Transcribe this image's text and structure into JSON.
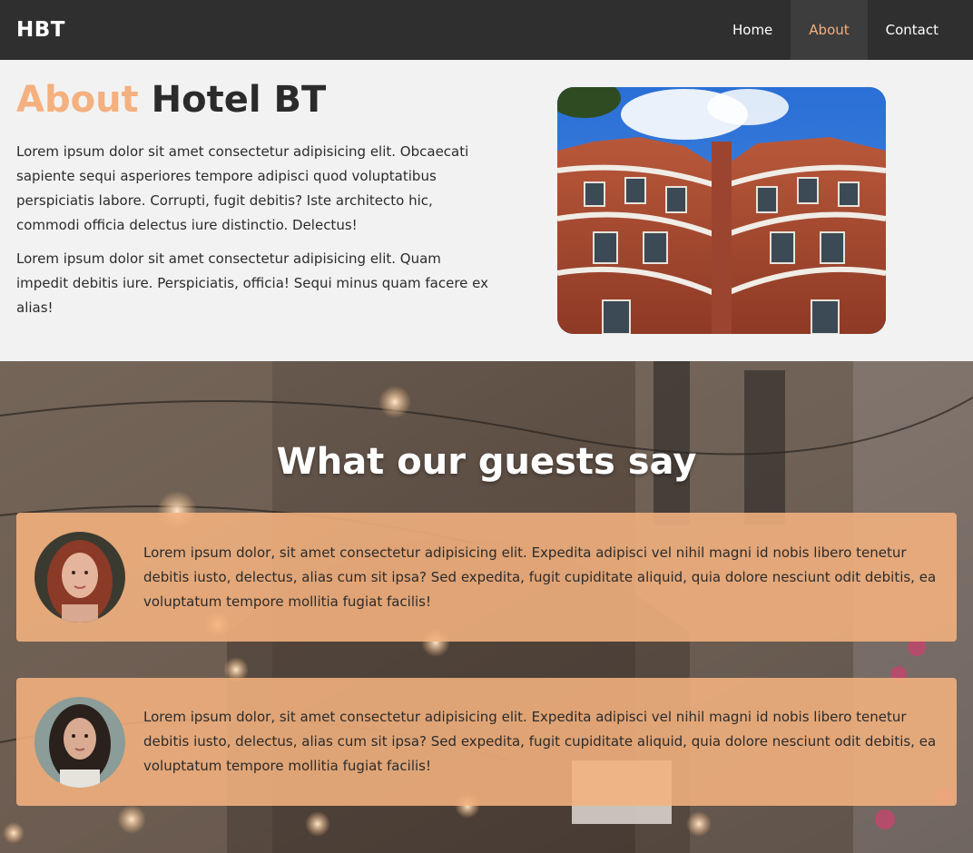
{
  "navbar": {
    "brand": "HBT",
    "links": [
      {
        "label": "Home",
        "active": false
      },
      {
        "label": "About",
        "active": true
      },
      {
        "label": "Contact",
        "active": false
      }
    ]
  },
  "about": {
    "title_accent": "About",
    "title_rest": "Hotel BT",
    "paragraphs": [
      "Lorem ipsum dolor sit amet consectetur adipisicing elit. Obcaecati sapiente sequi asperiores tempore adipisci quod voluptatibus perspiciatis labore. Corrupti, fugit debitis? Iste architecto hic, commodi officia delectus iure distinctio. Delectus!",
      "Lorem ipsum dolor sit amet consectetur adipisicing elit. Quam impedit debitis iure. Perspiciatis, officia! Sequi minus quam facere ex alias!"
    ]
  },
  "testimonials": {
    "title": "What our guests say",
    "items": [
      {
        "text": "Lorem ipsum dolor, sit amet consectetur adipisicing elit. Expedita adipisci vel nihil magni id nobis libero tenetur debitis iusto, delectus, alias cum sit ipsa? Sed expedita, fugit cupiditate aliquid, quia dolore nesciunt odit debitis, ea voluptatum tempore mollitia fugiat facilis!"
      },
      {
        "text": "Lorem ipsum dolor, sit amet consectetur adipisicing elit. Expedita adipisci vel nihil magni id nobis libero tenetur debitis iusto, delectus, alias cum sit ipsa? Sed expedita, fugit cupiditate aliquid, quia dolore nesciunt odit debitis, ea voluptatum tempore mollitia fugiat facilis!"
      }
    ]
  },
  "colors": {
    "accent": "#f4b07e",
    "navbar_bg": "#2f2f2f",
    "page_bg": "#f2f2f2",
    "card_bg": "#f4b27e"
  }
}
